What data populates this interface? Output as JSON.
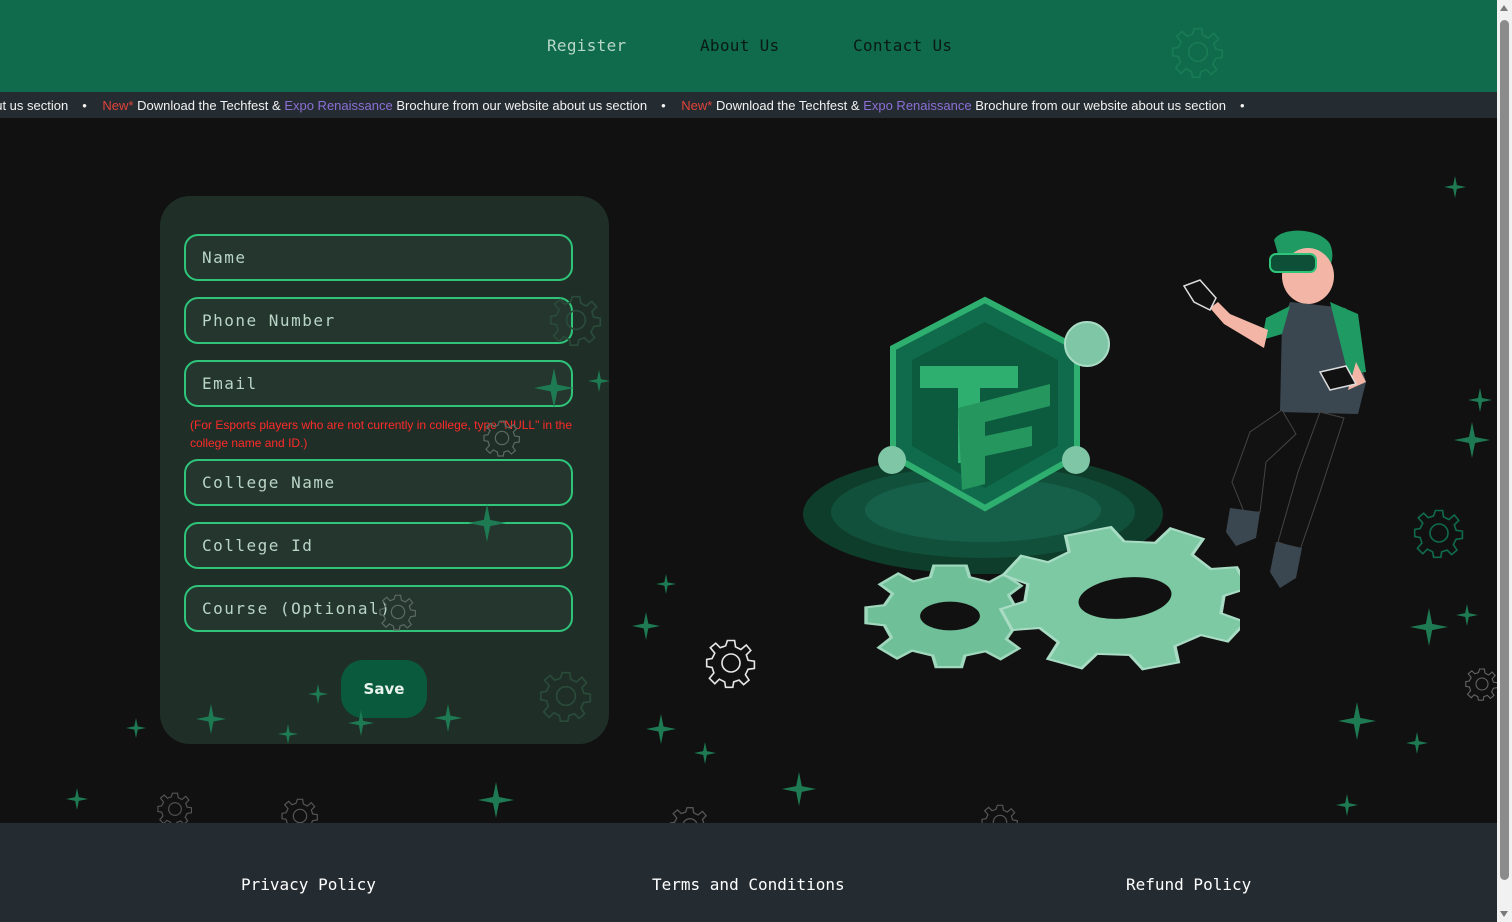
{
  "nav": {
    "register": "Register",
    "about": "About Us",
    "contact": "Contact Us"
  },
  "ticker": {
    "lead_text": "out us section",
    "new_label": "New*",
    "text_before": "Download the Techfest &",
    "expo": "Expo Renaissance",
    "text_after": "Brochure from our website about us section",
    "separator": "•"
  },
  "form": {
    "name_placeholder": "Name",
    "phone_placeholder": "Phone Number",
    "email_placeholder": "Email",
    "note": "(For Esports players who are not currently in college, type \"NULL\" in the college name and ID.)",
    "college_name_placeholder": "College Name",
    "college_id_placeholder": "College Id",
    "course_placeholder": "Course (Optional)",
    "save_label": "Save"
  },
  "footer": {
    "privacy": "Privacy Policy",
    "terms": "Terms and Conditions",
    "refund": "Refund Policy"
  },
  "colors": {
    "header_bg": "#0f6b4b",
    "accent": "#2fc47a",
    "note_red": "#ff2a2a",
    "footer_bg": "#252c31"
  }
}
